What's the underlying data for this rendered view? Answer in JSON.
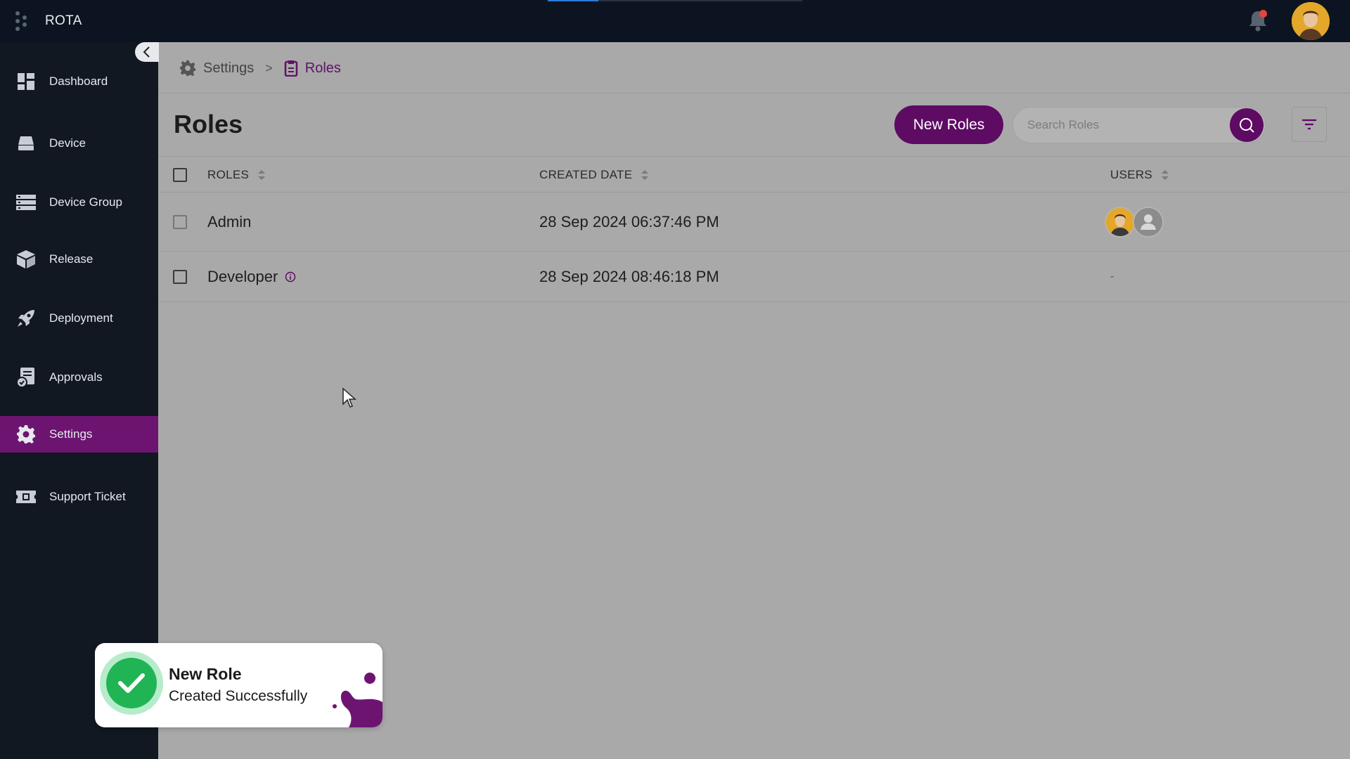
{
  "app": {
    "title": "ROTA",
    "loading_progress": 0.2
  },
  "header": {
    "notifications_icon": "bell-icon",
    "notification_badge_color": "#e2463b"
  },
  "sidebar": {
    "items": [
      {
        "label": "Dashboard",
        "icon": "dashboard-icon",
        "active": false
      },
      {
        "label": "Device",
        "icon": "device-icon",
        "active": false
      },
      {
        "label": "Device Group",
        "icon": "device-group-icon",
        "active": false
      },
      {
        "label": "Release",
        "icon": "package-icon",
        "active": false
      },
      {
        "label": "Deployment",
        "icon": "rocket-icon",
        "active": false
      },
      {
        "label": "Approvals",
        "icon": "approvals-icon",
        "active": false
      },
      {
        "label": "Settings",
        "icon": "gear-icon",
        "active": true
      },
      {
        "label": "Support Ticket",
        "icon": "ticket-icon",
        "active": false
      }
    ]
  },
  "breadcrumb": {
    "parent": "Settings",
    "current": "Roles"
  },
  "page": {
    "title": "Roles",
    "new_button": "New Roles",
    "search_placeholder": "Search Roles"
  },
  "table": {
    "columns": [
      "ROLES",
      "CREATED DATE",
      "USERS"
    ],
    "rows": [
      {
        "role": "Admin",
        "created": "28 Sep 2024 06:37:46 PM",
        "users": "2 avatars",
        "info": false
      },
      {
        "role": "Developer",
        "created": "28 Sep 2024 08:46:18 PM",
        "users": "-",
        "info": true
      }
    ]
  },
  "toast": {
    "title": "New Role",
    "message": "Created Successfully"
  },
  "colors": {
    "accent": "#5e0b63",
    "sidebar_bg": "#111822",
    "active_nav": "#6d1471",
    "success": "#21b454"
  }
}
